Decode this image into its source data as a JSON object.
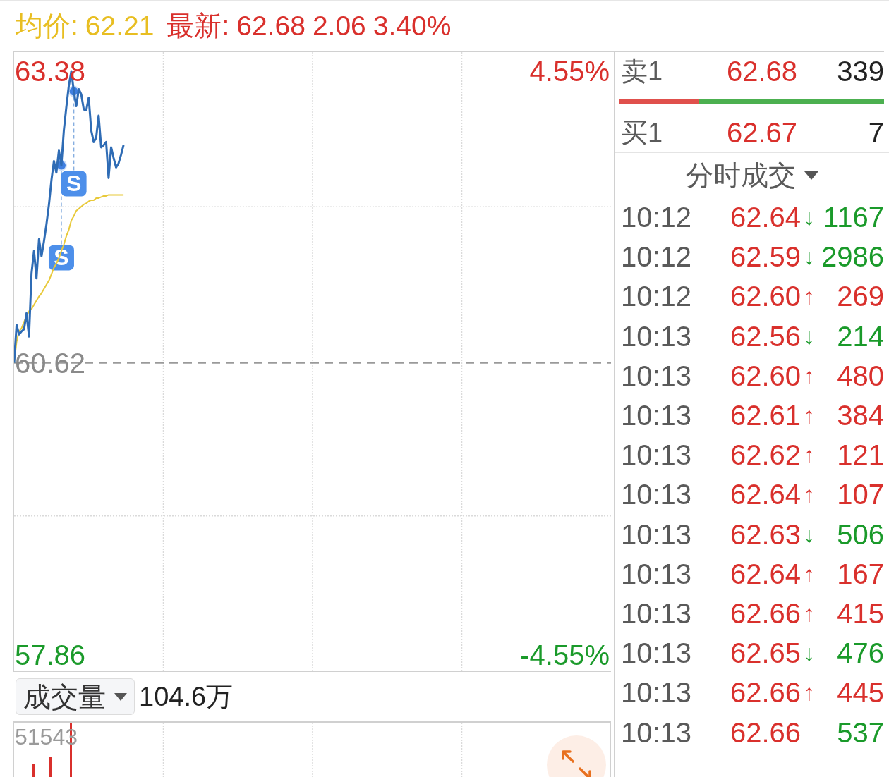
{
  "header": {
    "average_label": "均价:",
    "average_value": "62.21",
    "latest_label": "最新:",
    "latest_price": "62.68",
    "change": "2.06",
    "change_percent": "3.40%"
  },
  "price_chart": {
    "right_labels": [
      "4.55%",
      "-4.55%"
    ],
    "signal_markers": [
      "S",
      "S"
    ],
    "chart_data": {
      "type": "line",
      "ylim": [
        57.71,
        63.56
      ],
      "yticks": [
        {
          "value": 63.38,
          "label": "63.38"
        },
        {
          "value": 60.62,
          "label": "60.62"
        },
        {
          "value": 57.86,
          "label": "57.86"
        }
      ],
      "ref_lines": [
        {
          "axis": "y",
          "value": 60.62
        }
      ],
      "series": [
        {
          "color": "#2f6cb5",
          "values": [
            60.62,
            60.98,
            60.89,
            60.92,
            60.94,
            61.09,
            60.87,
            61.47,
            61.68,
            61.42,
            61.79,
            61.63,
            61.77,
            61.93,
            62.12,
            62.35,
            62.53,
            62.42,
            62.63,
            62.49,
            62.82,
            63.04,
            63.24,
            63.38,
            63.19,
            63.05,
            63.21,
            63.16,
            63.02,
            63.01,
            63.13,
            62.82,
            62.71,
            62.75,
            62.96,
            62.66,
            62.68,
            62.71,
            62.37,
            62.66,
            62.56,
            62.47,
            62.51,
            62.59,
            62.68,
            null,
            null,
            null,
            null,
            null,
            null,
            null,
            null,
            null,
            null,
            null,
            null,
            null,
            null,
            null,
            null,
            null,
            null,
            null,
            null,
            null,
            null,
            null,
            null,
            null,
            null,
            null,
            null,
            null,
            null,
            null,
            null,
            null,
            null,
            null,
            null,
            null,
            null,
            null,
            null,
            null,
            null,
            null,
            null,
            null,
            null,
            null,
            null,
            null,
            null,
            null,
            null,
            null,
            null,
            null,
            null,
            null,
            null,
            null,
            null,
            null,
            null,
            null,
            null,
            null,
            null,
            null,
            null,
            null,
            null,
            null,
            null,
            null,
            null,
            null,
            null,
            null,
            null,
            null,
            null,
            null,
            null,
            null,
            null,
            null,
            null,
            null,
            null,
            null,
            null,
            null,
            null,
            null,
            null,
            null,
            null,
            null,
            null,
            null,
            null,
            null,
            null,
            null,
            null,
            null,
            null,
            null,
            null,
            null,
            null,
            null,
            null,
            null,
            null,
            null,
            null,
            null,
            null,
            null,
            null,
            null,
            null,
            null,
            null,
            null,
            null,
            null,
            null,
            null,
            null,
            null,
            null,
            null,
            null,
            null,
            null,
            null,
            null,
            null,
            null,
            null,
            null,
            null,
            null,
            null,
            null,
            null,
            null,
            null,
            null,
            null,
            null,
            null,
            null,
            null,
            null,
            null,
            null,
            null,
            null,
            null,
            null,
            null,
            null,
            null,
            null,
            null,
            null,
            null,
            null,
            null,
            null,
            null,
            null,
            null,
            null,
            null,
            null,
            null,
            null,
            null,
            null,
            null,
            null,
            null,
            null,
            null,
            null,
            null,
            null,
            null,
            null,
            null,
            null,
            null,
            null
          ]
        },
        {
          "color": "#e8c93a",
          "values": [
            60.62,
            60.82,
            60.92,
            60.95,
            61.01,
            61.06,
            61.11,
            61.13,
            61.17,
            61.21,
            61.25,
            61.28,
            61.32,
            61.36,
            61.4,
            61.46,
            61.52,
            61.56,
            61.61,
            61.68,
            61.74,
            61.82,
            61.88,
            61.97,
            62.01,
            62.06,
            62.08,
            62.1,
            62.12,
            62.13,
            62.15,
            62.16,
            62.16,
            62.18,
            62.18,
            62.19,
            62.2,
            62.2,
            62.21,
            62.21,
            62.21,
            62.21,
            62.21,
            62.21,
            62.21,
            null,
            null,
            null,
            null,
            null,
            null,
            null,
            null,
            null,
            null,
            null,
            null,
            null,
            null,
            null,
            null,
            null,
            null,
            null,
            null,
            null,
            null,
            null,
            null,
            null,
            null,
            null,
            null,
            null,
            null,
            null,
            null,
            null,
            null,
            null,
            null,
            null,
            null,
            null,
            null,
            null,
            null,
            null,
            null,
            null,
            null,
            null,
            null,
            null,
            null,
            null,
            null,
            null,
            null,
            null,
            null,
            null,
            null,
            null,
            null,
            null,
            null,
            null,
            null,
            null,
            null,
            null,
            null,
            null,
            null,
            null,
            null,
            null,
            null,
            null,
            null,
            null,
            null,
            null,
            null,
            null,
            null,
            null,
            null,
            null,
            null,
            null,
            null,
            null,
            null,
            null,
            null,
            null,
            null,
            null,
            null,
            null,
            null,
            null,
            null,
            null,
            null,
            null,
            null,
            null,
            null,
            null,
            null,
            null,
            null,
            null,
            null,
            null,
            null,
            null,
            null,
            null,
            null,
            null,
            null,
            null,
            null,
            null,
            null,
            null,
            null,
            null,
            null,
            null,
            null,
            null,
            null,
            null,
            null,
            null,
            null,
            null,
            null,
            null,
            null,
            null,
            null,
            null,
            null,
            null,
            null,
            null,
            null,
            null,
            null,
            null,
            null,
            null,
            null,
            null,
            null,
            null,
            null,
            null,
            null,
            null,
            null,
            null,
            null,
            null,
            null,
            null,
            null,
            null,
            null,
            null,
            null,
            null,
            null,
            null,
            null,
            null,
            null,
            null,
            null,
            null,
            null,
            null,
            null,
            null,
            null,
            null,
            null,
            null,
            null,
            null,
            null,
            null,
            null,
            null,
            null
          ]
        }
      ]
    }
  },
  "volume": {
    "selector": "成交量",
    "total": "104.6万",
    "max_label": "51543"
  },
  "order_book": {
    "asks": [
      {
        "label": "卖1",
        "price": "62.68",
        "volume": "339"
      }
    ],
    "ratio_bar": {
      "level": 0.3
    },
    "bids": [
      {
        "label": "买1",
        "price": "62.67",
        "volume": "7"
      }
    ]
  },
  "trades": {
    "title": "分时成交",
    "rows": [
      {
        "time": "10:12",
        "price": "62.64",
        "arrow": "↓",
        "volume": "1167",
        "color": "#1a9a2a"
      },
      {
        "time": "10:12",
        "price": "62.59",
        "arrow": "↓",
        "volume": "2986",
        "color": "#1a9a2a"
      },
      {
        "time": "10:12",
        "price": "62.60",
        "arrow": "↑",
        "volume": "269",
        "color": "#d9302c"
      },
      {
        "time": "10:13",
        "price": "62.56",
        "arrow": "↓",
        "volume": "214",
        "color": "#1a9a2a"
      },
      {
        "time": "10:13",
        "price": "62.60",
        "arrow": "↑",
        "volume": "480",
        "color": "#d9302c"
      },
      {
        "time": "10:13",
        "price": "62.61",
        "arrow": "↑",
        "volume": "384",
        "color": "#d9302c"
      },
      {
        "time": "10:13",
        "price": "62.62",
        "arrow": "↑",
        "volume": "121",
        "color": "#d9302c"
      },
      {
        "time": "10:13",
        "price": "62.64",
        "arrow": "↑",
        "volume": "107",
        "color": "#d9302c"
      },
      {
        "time": "10:13",
        "price": "62.63",
        "arrow": "↓",
        "volume": "506",
        "color": "#1a9a2a"
      },
      {
        "time": "10:13",
        "price": "62.64",
        "arrow": "↑",
        "volume": "167",
        "color": "#d9302c"
      },
      {
        "time": "10:13",
        "price": "62.66",
        "arrow": "↑",
        "volume": "415",
        "color": "#d9302c"
      },
      {
        "time": "10:13",
        "price": "62.65",
        "arrow": "↓",
        "volume": "476",
        "color": "#1a9a2a"
      },
      {
        "time": "10:13",
        "price": "62.66",
        "arrow": "↑",
        "volume": "445",
        "color": "#d9302c"
      },
      {
        "time": "10:13",
        "price": "62.66",
        "volume": "537",
        "color": "#1a9a2a"
      }
    ]
  }
}
